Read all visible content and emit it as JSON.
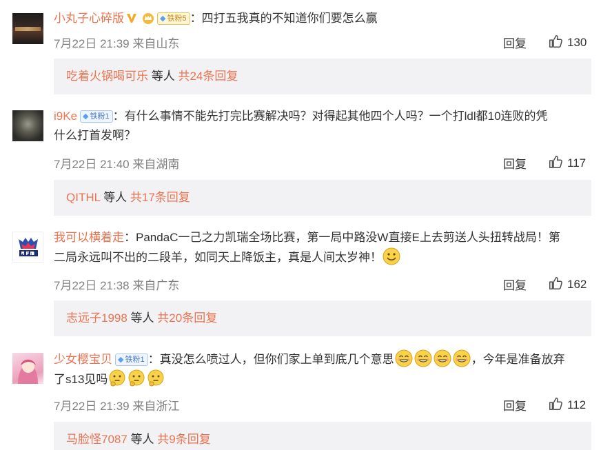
{
  "comments": [
    {
      "username": "小丸子心碎版",
      "fan_badge": "铁粉5",
      "colon": "：",
      "text1": "四打五我真的不知道你们要怎么赢",
      "text2": "",
      "time": "7月22日 21:39",
      "location": "来自山东",
      "reply_label": "回复",
      "likes": "130",
      "sub_user": "吃着火锅喝可乐",
      "sub_mid": " 等人 ",
      "sub_total": "共24条回复"
    },
    {
      "username": "i9Ke",
      "fan_badge": "铁粉1",
      "colon": "：",
      "text1": "有什么事情不能先打完比赛解决吗？对得起其他四个人吗？一个打ldl都10连败的凭",
      "text2": "什么打首发啊？",
      "time": "7月22日 21:40",
      "location": "来自湖南",
      "reply_label": "回复",
      "likes": "117",
      "sub_user": "QITHL",
      "sub_mid": " 等人 ",
      "sub_total": "共17条回复"
    },
    {
      "username": "我可以横着走",
      "fan_badge": "",
      "colon": "：",
      "text1": "PandaC一己之力凯瑞全场比赛，第一局中路没W直接E上去剪送人头扭转战局！第",
      "text2": "二局永远叫不出的二段羊，如同天上降饭主，真是人间太岁神！",
      "time": "7月22日 21:38",
      "location": "来自广东",
      "reply_label": "回复",
      "likes": "162",
      "sub_user": "志远子1998",
      "sub_mid": " 等人 ",
      "sub_total": "共20条回复"
    },
    {
      "username": "少女樱宝贝",
      "fan_badge": "铁粉1",
      "colon": "：",
      "text1": "真没怎么喷过人，但你们家上单到底几个意思",
      "text1b": "，今年是准备放弃",
      "text2": "了s13见吗",
      "time": "7月22日 21:39",
      "location": "来自浙江",
      "reply_label": "回复",
      "likes": "112",
      "sub_user": "马脸怪7087",
      "sub_mid": " 等人 ",
      "sub_total": "共9条回复"
    }
  ],
  "colors": {
    "username": "#eb7350",
    "meta": "#808080",
    "text": "#333333",
    "sub_bg": "#f2f2f5"
  },
  "icons": {
    "like": "thumbs-up-icon",
    "vip": "verified-v-icon",
    "crown": "crown-icon",
    "emoji_smile": "smile-emoji",
    "emoji_grin": "grin-emoji",
    "emoji_thinking": "thinking-emoji"
  }
}
